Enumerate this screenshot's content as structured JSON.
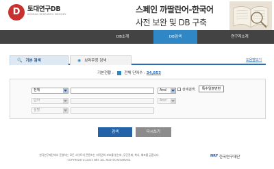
{
  "header": {
    "logo_mark": "D",
    "logo_title": "토대연구DB",
    "logo_subtitle": "KOREAN RESEARCH MEMORY",
    "hero_title": "스페인 까딸란어-한국어",
    "hero_subtitle": "사전 보완 및 DB 구축"
  },
  "nav": {
    "items": [
      {
        "label": "DB소개"
      },
      {
        "label": "DB검색"
      },
      {
        "label": "연구자소개"
      }
    ],
    "active_color": "#2f87c6"
  },
  "tabs": {
    "basic": "기본 검색",
    "browse": "브라우징 검색",
    "basic_icon": "search-icon",
    "browse_icon": "browse-icon"
  },
  "help_link": "도움말보기",
  "status": {
    "label": "기본현황 :",
    "total_label": "전체 단어수 :",
    "total_count": "34,853"
  },
  "search": {
    "row1": {
      "field": "전체",
      "operator": "And"
    },
    "row2": {
      "field": "단어",
      "operator": "And"
    },
    "row3": {
      "field": "설명"
    },
    "detail_label": "상세검색",
    "special_chars_button": "특수일괄변환"
  },
  "buttons": {
    "search": "검색",
    "reset": "다시쓰기"
  },
  "footer": {
    "line1": "한국연구재단에서 운영하는 모든 사이트의 콘텐츠는 저작권의 보호를 받는바, 무단전재, 복사, 배포를 금합니다.",
    "line2": "COPYRIGHT(C)2013 NRF. ALL RIGHTS RESERVED.",
    "logo_mark": "NRF",
    "logo_text": "한국연구재단"
  }
}
